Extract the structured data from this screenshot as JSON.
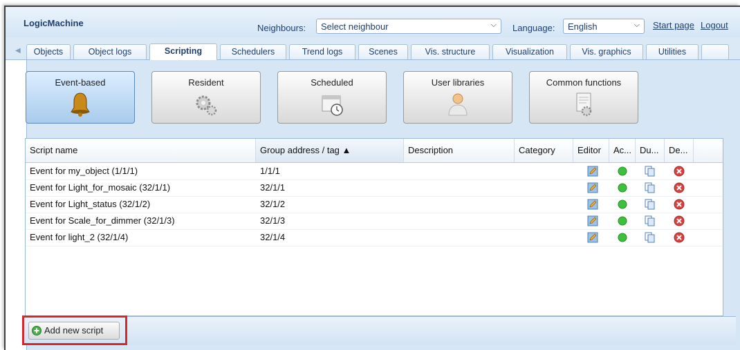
{
  "header": {
    "brand": "LogicMachine",
    "neighbours_label": "Neighbours:",
    "neighbours_value": "Select neighbour",
    "language_label": "Language:",
    "language_value": "English",
    "start_page": "Start page",
    "logout": "Logout"
  },
  "tabs": [
    {
      "label": "Objects"
    },
    {
      "label": "Object logs"
    },
    {
      "label": "Scripting",
      "active": true
    },
    {
      "label": "Schedulers"
    },
    {
      "label": "Trend logs"
    },
    {
      "label": "Scenes"
    },
    {
      "label": "Vis. structure"
    },
    {
      "label": "Visualization"
    },
    {
      "label": "Vis. graphics"
    },
    {
      "label": "Utilities"
    }
  ],
  "categories": [
    {
      "label": "Event-based",
      "icon": "bell-icon",
      "active": true
    },
    {
      "label": "Resident",
      "icon": "gears-icon"
    },
    {
      "label": "Scheduled",
      "icon": "calendar-clock-icon"
    },
    {
      "label": "User libraries",
      "icon": "user-icon"
    },
    {
      "label": "Common functions",
      "icon": "document-gear-icon"
    }
  ],
  "table": {
    "columns": [
      "Script name",
      "Group address / tag ▲",
      "Description",
      "Category",
      "Editor",
      "Ac...",
      "Du...",
      "De..."
    ],
    "rows": [
      {
        "name": "Event for my_object (1/1/1)",
        "address": "1/1/1"
      },
      {
        "name": "Event for Light_for_mosaic (32/1/1)",
        "address": "32/1/1"
      },
      {
        "name": "Event for Light_status (32/1/2)",
        "address": "32/1/2"
      },
      {
        "name": "Event for Scale_for_dimmer (32/1/3)",
        "address": "32/1/3"
      },
      {
        "name": "Event for light_2 (32/1/4)",
        "address": "32/1/4"
      }
    ]
  },
  "footer": {
    "add_button": "Add new script"
  },
  "colors": {
    "accent": "#1f3f6f",
    "highlight": "#d9262a",
    "active_green": "#3bc13b",
    "delete_red": "#d9413d"
  }
}
